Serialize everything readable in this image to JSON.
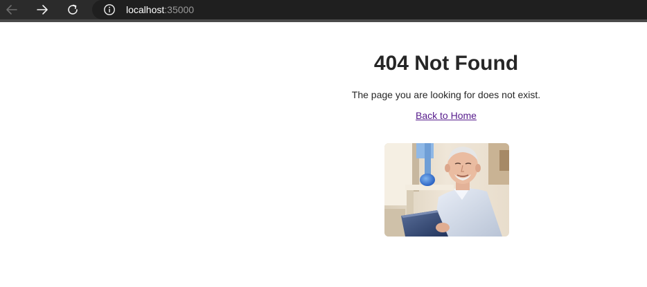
{
  "browser": {
    "url_host": "localhost",
    "url_port": ":35000",
    "icons": {
      "back": "arrow-left-icon",
      "forward": "arrow-right-icon",
      "reload": "reload-icon",
      "site_info": "info-icon"
    }
  },
  "page": {
    "title": "404 Not Found",
    "message": "The page you are looking for does not exist.",
    "link_label": "Back to Home",
    "link_color": "#551a8b",
    "text_color": "#262626"
  },
  "image": {
    "description_name": "man-with-laptop-photo"
  }
}
